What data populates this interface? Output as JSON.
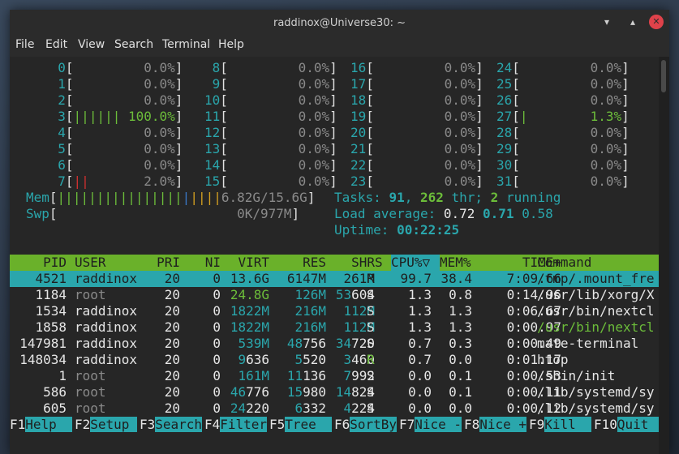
{
  "window": {
    "title": "raddinox@Universe30: ~",
    "min": "▾",
    "max": "▴",
    "close": "✕"
  },
  "menu": [
    "File",
    "Edit",
    "View",
    "Search",
    "Terminal",
    "Help"
  ],
  "cpus": [
    {
      "id": "0",
      "bar": "",
      "pct": "0.0%"
    },
    {
      "id": "1",
      "bar": "",
      "pct": "0.0%"
    },
    {
      "id": "2",
      "bar": "",
      "pct": "0.0%"
    },
    {
      "id": "3",
      "bar": "||||||",
      "pct": "100.0%"
    },
    {
      "id": "4",
      "bar": "",
      "pct": "0.0%"
    },
    {
      "id": "5",
      "bar": "",
      "pct": "0.0%"
    },
    {
      "id": "6",
      "bar": "",
      "pct": "0.0%"
    },
    {
      "id": "7",
      "bar": "||",
      "pct": "2.0%"
    },
    {
      "id": "8",
      "bar": "",
      "pct": "0.0%"
    },
    {
      "id": "9",
      "bar": "",
      "pct": "0.0%"
    },
    {
      "id": "10",
      "bar": "",
      "pct": "0.0%"
    },
    {
      "id": "11",
      "bar": "",
      "pct": "0.0%"
    },
    {
      "id": "12",
      "bar": "",
      "pct": "0.0%"
    },
    {
      "id": "13",
      "bar": "",
      "pct": "0.0%"
    },
    {
      "id": "14",
      "bar": "",
      "pct": "0.0%"
    },
    {
      "id": "15",
      "bar": "",
      "pct": "0.0%"
    },
    {
      "id": "16",
      "bar": "",
      "pct": "0.0%"
    },
    {
      "id": "17",
      "bar": "",
      "pct": "0.0%"
    },
    {
      "id": "18",
      "bar": "",
      "pct": "0.0%"
    },
    {
      "id": "19",
      "bar": "",
      "pct": "0.0%"
    },
    {
      "id": "20",
      "bar": "",
      "pct": "0.0%"
    },
    {
      "id": "21",
      "bar": "",
      "pct": "0.0%"
    },
    {
      "id": "22",
      "bar": "",
      "pct": "0.0%"
    },
    {
      "id": "23",
      "bar": "",
      "pct": "0.0%"
    },
    {
      "id": "24",
      "bar": "",
      "pct": "0.0%"
    },
    {
      "id": "25",
      "bar": "",
      "pct": "0.0%"
    },
    {
      "id": "26",
      "bar": "",
      "pct": "0.0%"
    },
    {
      "id": "27",
      "bar": "|",
      "pct": "1.3%"
    },
    {
      "id": "28",
      "bar": "",
      "pct": "0.0%"
    },
    {
      "id": "29",
      "bar": "",
      "pct": "0.0%"
    },
    {
      "id": "30",
      "bar": "",
      "pct": "0.0%"
    },
    {
      "id": "31",
      "bar": "",
      "pct": "0.0%"
    }
  ],
  "mem": {
    "label": "Mem",
    "value": "6.82G/15.6G"
  },
  "swp": {
    "label": "Swp",
    "value": "0K/977M"
  },
  "tasks": {
    "label": "Tasks:",
    "count": "91",
    "threads": "262",
    "thr_label": "thr;",
    "running": "2",
    "running_label": "running"
  },
  "load": {
    "label": "Load average:",
    "l1": "0.72",
    "l5": "0.71",
    "l15": "0.58"
  },
  "uptime": {
    "label": "Uptime:",
    "value": "00:22:25"
  },
  "columns": [
    "PID",
    "USER",
    "PRI",
    "NI",
    "VIRT",
    "RES",
    "SHR",
    "S",
    "CPU%▽",
    "MEM%",
    "TIME+",
    "Command"
  ],
  "processes": [
    {
      "pid": "4521",
      "user": "raddinox",
      "pri": "20",
      "ni": "0",
      "virt": "13.6G",
      "res": "6147M",
      "shr": "261M",
      "s": "R",
      "cpu": "99.7",
      "mem": "38.4",
      "time": "7:09.66",
      "cmd": "/tmp/.mount_fre"
    },
    {
      "pid": "1184",
      "user": "root",
      "pri": "20",
      "ni": "0",
      "virt": "24.8G",
      "res": "126M",
      "shr": "53604",
      "s": "S",
      "cpu": "1.3",
      "mem": "0.8",
      "time": "0:14.96",
      "cmd": "/usr/lib/xorg/X"
    },
    {
      "pid": "1534",
      "user": "raddinox",
      "pri": "20",
      "ni": "0",
      "virt": "1822M",
      "res": "216M",
      "shr": "112M",
      "s": "S",
      "cpu": "1.3",
      "mem": "1.3",
      "time": "0:06.67",
      "cmd": "/usr/bin/nextcl"
    },
    {
      "pid": "1858",
      "user": "raddinox",
      "pri": "20",
      "ni": "0",
      "virt": "1822M",
      "res": "216M",
      "shr": "112M",
      "s": "S",
      "cpu": "1.3",
      "mem": "1.3",
      "time": "0:00.97",
      "cmd": "/usr/bin/nextcl"
    },
    {
      "pid": "147981",
      "user": "raddinox",
      "pri": "20",
      "ni": "0",
      "virt": "539M",
      "res": "48756",
      "shr": "34720",
      "s": "S",
      "cpu": "0.7",
      "mem": "0.3",
      "time": "0:00.49",
      "cmd": "mate-terminal"
    },
    {
      "pid": "148034",
      "user": "raddinox",
      "pri": "20",
      "ni": "0",
      "virt": "9636",
      "res": "5520",
      "shr": "3460",
      "s": "R",
      "cpu": "0.7",
      "mem": "0.0",
      "time": "0:01.17",
      "cmd": "htop"
    },
    {
      "pid": "1",
      "user": "root",
      "pri": "20",
      "ni": "0",
      "virt": "161M",
      "res": "11136",
      "shr": "7992",
      "s": "S",
      "cpu": "0.0",
      "mem": "0.1",
      "time": "0:00.53",
      "cmd": "/sbin/init"
    },
    {
      "pid": "586",
      "user": "root",
      "pri": "20",
      "ni": "0",
      "virt": "46776",
      "res": "15980",
      "shr": "14824",
      "s": "S",
      "cpu": "0.0",
      "mem": "0.1",
      "time": "0:00.11",
      "cmd": "/lib/systemd/sy"
    },
    {
      "pid": "605",
      "user": "root",
      "pri": "20",
      "ni": "0",
      "virt": "24220",
      "res": "6332",
      "shr": "4224",
      "s": "S",
      "cpu": "0.0",
      "mem": "0.0",
      "time": "0:00.12",
      "cmd": "/lib/systemd/sy"
    }
  ],
  "fkeys": [
    {
      "key": "F1",
      "label": "Help"
    },
    {
      "key": "F2",
      "label": "Setup"
    },
    {
      "key": "F3",
      "label": "Search"
    },
    {
      "key": "F4",
      "label": "Filter"
    },
    {
      "key": "F5",
      "label": "Tree"
    },
    {
      "key": "F6",
      "label": "SortBy"
    },
    {
      "key": "F7",
      "label": "Nice -"
    },
    {
      "key": "F8",
      "label": "Nice +"
    },
    {
      "key": "F9",
      "label": "Kill"
    },
    {
      "key": "F10",
      "label": "Quit"
    }
  ]
}
